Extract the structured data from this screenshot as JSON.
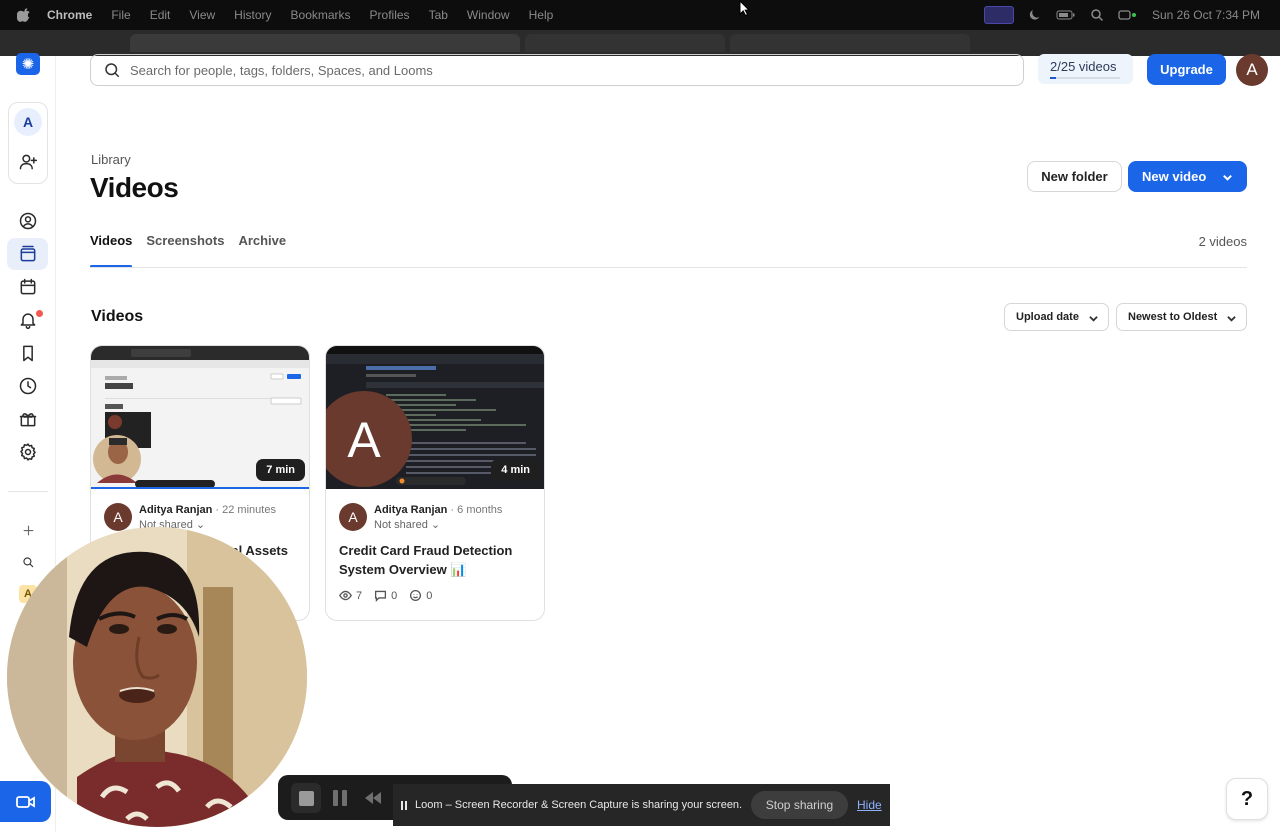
{
  "menubar": {
    "app_name": "Chrome",
    "items": [
      "File",
      "Edit",
      "View",
      "History",
      "Bookmarks",
      "Profiles",
      "Tab",
      "Window",
      "Help"
    ],
    "datetime": "Sun 26 Oct  7:34 PM"
  },
  "header": {
    "search_placeholder": "Search for people, tags, folders, Spaces, and Looms",
    "quota_label": "2/25 videos",
    "quota_fraction": 0.08,
    "upgrade_label": "Upgrade",
    "avatar_initial": "A"
  },
  "sidebar": {
    "workspace_initial": "A",
    "bottom_initial": "A",
    "icons": [
      "add-user-icon",
      "profile-icon",
      "library-icon",
      "calendar-icon",
      "bell-icon",
      "bookmark-icon",
      "clock-icon",
      "gift-icon",
      "gear-icon",
      "plus-icon",
      "search-icon"
    ]
  },
  "page": {
    "breadcrumb": "Library",
    "title": "Videos",
    "new_folder_label": "New folder",
    "new_video_label": "New video",
    "tabs": [
      {
        "label": "Videos",
        "active": true
      },
      {
        "label": "Screenshots",
        "active": false
      },
      {
        "label": "Archive",
        "active": false
      }
    ],
    "count": "2 videos",
    "section_title": "Videos",
    "sort_by": "Upload date",
    "sort_order": "Newest to Oldest"
  },
  "videos": [
    {
      "duration": "7 min",
      "author_initial": "A",
      "author": "Aditya Ranjan",
      "ago": "· 22 minutes",
      "share": "Not shared",
      "title": "ital Assets",
      "views": "",
      "comments": "",
      "reactions": ""
    },
    {
      "duration": "4 min",
      "author_initial": "A",
      "author": "Aditya Ranjan",
      "ago": "· 6 months",
      "share": "Not shared",
      "title": "Credit Card Fraud Detection System Overview 📊",
      "views": "7",
      "comments": "0",
      "reactions": "0"
    }
  ],
  "recorder": {
    "share_message": "Loom – Screen Recorder & Screen Capture is sharing your screen.",
    "stop_sharing_label": "Stop sharing",
    "hide_label": "Hide"
  },
  "help_label": "?",
  "colors": {
    "brand_blue": "#1a65e8",
    "avatar_brown": "#6b3a2e",
    "notification_red": "#f05a4f"
  }
}
